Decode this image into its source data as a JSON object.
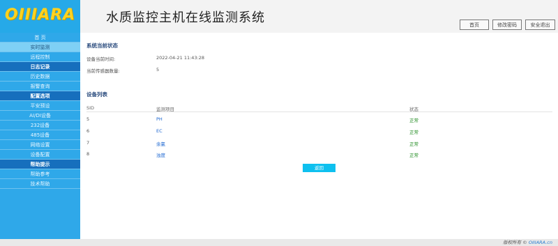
{
  "header": {
    "logo_text": "OIIIARA",
    "title": "水质监控主机在线监测系统",
    "buttons": [
      "首页",
      "修改密码",
      "安全退出"
    ]
  },
  "sidebar": {
    "items": [
      {
        "label": "首 页",
        "type": "item"
      },
      {
        "label": "实时监测",
        "type": "active"
      },
      {
        "label": "远程控制",
        "type": "item"
      },
      {
        "label": "日志记录",
        "type": "header"
      },
      {
        "label": "历史数据",
        "type": "item"
      },
      {
        "label": "报警查询",
        "type": "item"
      },
      {
        "label": "配置选项",
        "type": "header"
      },
      {
        "label": "平安预设",
        "type": "item"
      },
      {
        "label": "AI/DI设备",
        "type": "item"
      },
      {
        "label": "232设备",
        "type": "item"
      },
      {
        "label": "485设备",
        "type": "item"
      },
      {
        "label": "网络设置",
        "type": "item"
      },
      {
        "label": "设备配置",
        "type": "item"
      },
      {
        "label": "帮助提示",
        "type": "header"
      },
      {
        "label": "帮助参考",
        "type": "item"
      },
      {
        "label": "技术帮助",
        "type": "item"
      }
    ]
  },
  "status_section": {
    "title": "系统当前状态",
    "rows": [
      {
        "label": "设备当前时间:",
        "value": "2022-04-21 11:43:28"
      },
      {
        "label": "当前传感器数量:",
        "value": "5"
      }
    ]
  },
  "device_section": {
    "title": "设备列表",
    "columns": [
      "SID",
      "监测项目",
      "状态"
    ],
    "rows": [
      {
        "sid": "5",
        "item": "PH",
        "status": "正常"
      },
      {
        "sid": "6",
        "item": "EC",
        "status": "正常"
      },
      {
        "sid": "7",
        "item": "余氯",
        "status": "正常"
      },
      {
        "sid": "8",
        "item": "浊度",
        "status": "正常"
      }
    ]
  },
  "back_button": "返回",
  "footer": {
    "prefix": "版权所有 ©",
    "brand": "OIIIARA.cn"
  },
  "colors": {
    "sidebar": "#2fa8e9",
    "sidebar_header": "#166fbd",
    "accent": "#0ec0ef",
    "status_ok": "#1e8a1e"
  }
}
